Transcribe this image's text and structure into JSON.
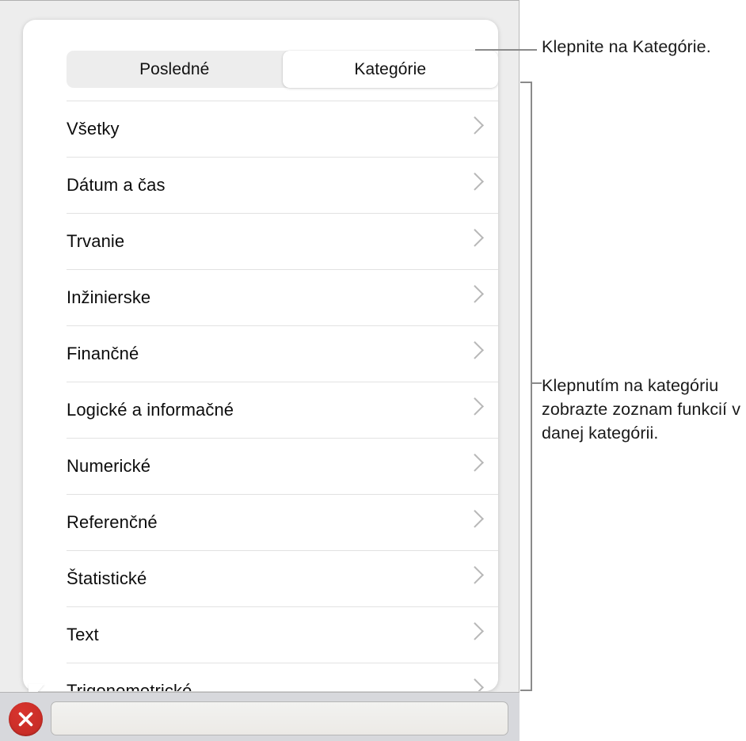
{
  "window": {
    "background_color": "#ededed"
  },
  "popover": {
    "segmented_control": {
      "name": "function-browser-tabs",
      "options": [
        {
          "label": "Posledné",
          "active": false
        },
        {
          "label": "Kategórie",
          "active": true
        }
      ]
    },
    "category_list": {
      "disclosure_icon": "chevron-right-icon",
      "items": [
        {
          "label": "Všetky"
        },
        {
          "label": "Dátum a čas"
        },
        {
          "label": "Trvanie"
        },
        {
          "label": "Inžinierske"
        },
        {
          "label": "Finančné"
        },
        {
          "label": "Logické a informačné"
        },
        {
          "label": "Numerické"
        },
        {
          "label": "Referenčné"
        },
        {
          "label": "Štatistické"
        },
        {
          "label": "Text"
        },
        {
          "label": "Trigonometrické"
        }
      ]
    }
  },
  "bottom_toolbar": {
    "close_button": {
      "icon": "close-x-icon",
      "color": "#c9302c",
      "label": ""
    },
    "formula_field": {
      "value": "",
      "placeholder": ""
    }
  },
  "annotations": [
    {
      "id": "callout-1",
      "text": "Klepnite na Kategórie.",
      "connector": "line"
    },
    {
      "id": "callout-2",
      "text": "Klepnutím na kategóriu zobrazte zoznam funkcií v danej kategórii.",
      "connector": "bracket"
    }
  ],
  "colors": {
    "accent_red": "#c9302c",
    "chrome_grey": "#ededed",
    "toolbar_grey": "#d7d8dc",
    "divider": "#e2e2e2",
    "chevron": "#b8b8b8",
    "annotation_line": "#8a8a8a"
  }
}
